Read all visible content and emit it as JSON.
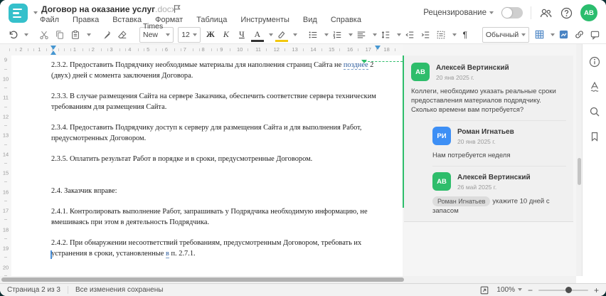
{
  "header": {
    "title": "Договор на оказание услуг",
    "title_ext": ".docx",
    "menu": [
      "Файл",
      "Правка",
      "Вставка",
      "Формат",
      "Таблица",
      "Инструменты",
      "Вид",
      "Справка"
    ],
    "review_mode_label": "Рецензирование",
    "avatar_initials": "АВ"
  },
  "toolbar": {
    "font_name": "Times New ...",
    "font_size": "12",
    "bold_label": "Ж",
    "italic_label": "К",
    "underline_label": "Ч",
    "font_color_letter": "А",
    "pilcrow": "¶",
    "style_name": "Обычный",
    "more_label": "···"
  },
  "ruler": {
    "h_left_numbers": [
      "2",
      "1"
    ],
    "h_numbers": [
      "1",
      "2",
      "3",
      "4",
      "5",
      "6",
      "7",
      "8",
      "9",
      "10",
      "11",
      "12",
      "13",
      "14",
      "15",
      "16",
      "17",
      "18"
    ],
    "v_numbers": [
      "9",
      "10",
      "11",
      "12",
      "13",
      "14",
      "15",
      "16",
      "17",
      "18",
      "19",
      "20"
    ]
  },
  "document": {
    "p_2_3_2": {
      "before": "2.3.2. Предоставить Подрядчику необходимые материалы для наполнения страниц Сайта не ",
      "tracked": "позднее",
      "after": " 2 (двух) дней с момента заключения Договора."
    },
    "p_2_3_3": "2.3.3. В случае размещения Сайта на сервере Заказчика, обеспечить соответствие сервера техническим требованиям для размещения Сайта.",
    "p_2_3_4": "2.3.4. Предоставить Подрядчику доступ к серверу для размещения Сайта и для выполнения Работ, предусмотренных Договором.",
    "p_2_3_5": "2.3.5. Оплатить результат Работ в порядке и в сроки, предусмотренные Договором.",
    "p_2_4": "2.4. Заказчик вправе:",
    "p_2_4_1": "2.4.1. Контролировать выполнение Работ, запрашивать у Подрядчика необходимую информацию, не вмешиваясь при этом в деятельность Подрядчика.",
    "p_2_4_2": {
      "before": "2.4.2. При обнаружении несоответствий требованиям, предусмотренным Договором, требовать их устранения в сроки, установленные ",
      "tracked": "в",
      "after": " п. 2.7.1."
    }
  },
  "comments": [
    {
      "initials": "АВ",
      "name": "Алексей Вертинский",
      "date": "20 янв 2025 г.",
      "text": "Коллеги, необходимо указать реальные сроки предоставления материалов подрядчику. Сколько времени вам потребуется?"
    },
    {
      "initials": "РИ",
      "name": "Роман Игнатьев",
      "date": "20 янв 2025 г.",
      "text": "Нам потребуется неделя"
    },
    {
      "initials": "АВ",
      "name": "Алексей Вертинский",
      "date": "26 май 2025 г.",
      "mention": "Роман Игнатьев",
      "text": "укажите 10 дней с запасом"
    }
  ],
  "statusbar": {
    "page_indicator": "Страница 2 из 3",
    "save_status": "Все изменения сохранены",
    "zoom_level": "100%",
    "zoom_out": "−",
    "zoom_in": "+"
  },
  "colors": {
    "accent_teal": "#35c0cb",
    "comment_green": "#2ebd6b",
    "reply_blue": "#3d8ff5"
  }
}
